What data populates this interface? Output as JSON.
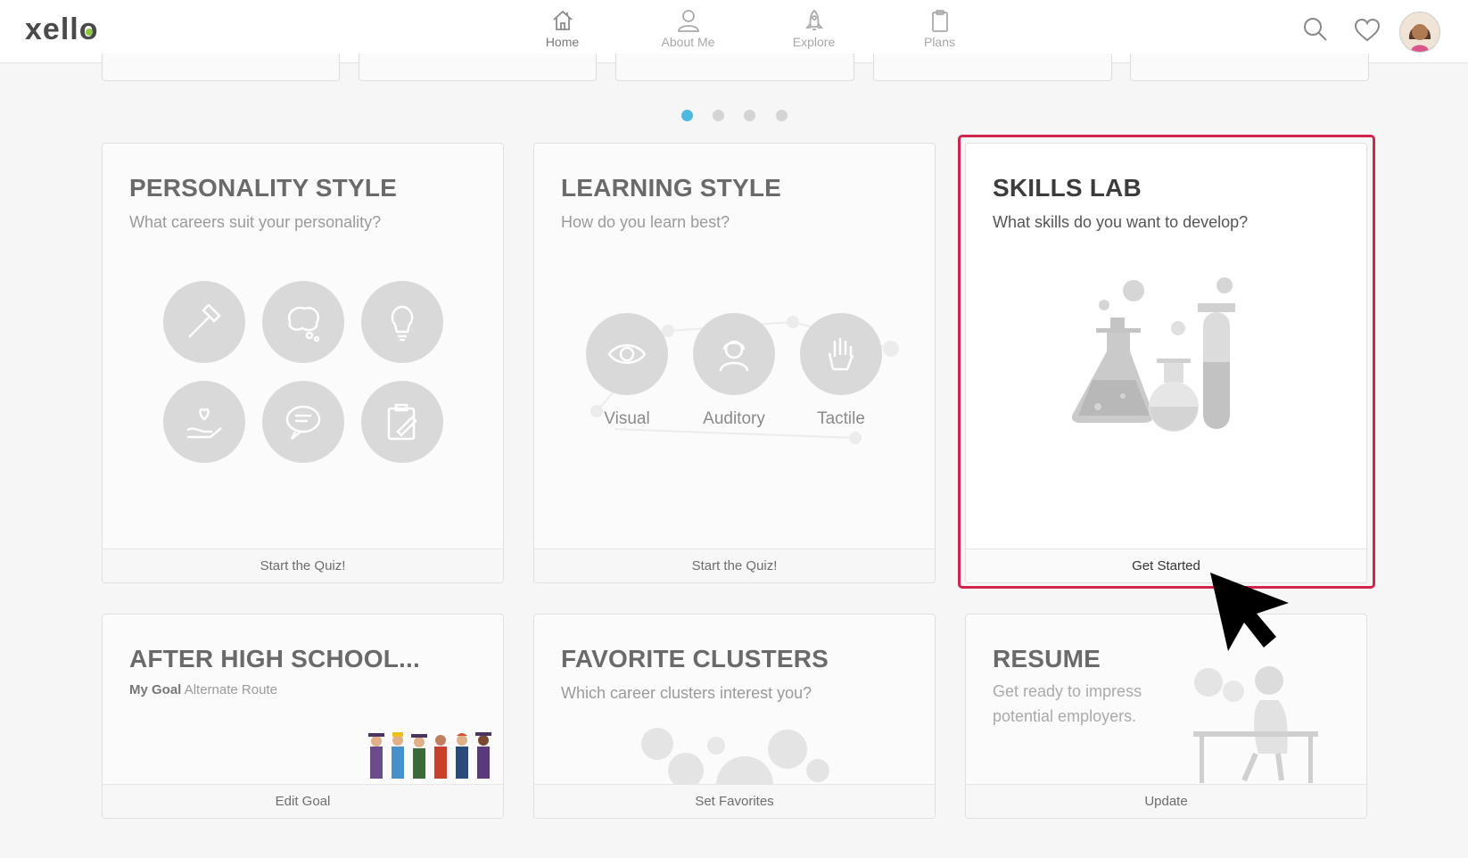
{
  "app": {
    "logo": "xello"
  },
  "nav": {
    "items": [
      {
        "label": "Home",
        "icon": "home-icon",
        "active": true
      },
      {
        "label": "About Me",
        "icon": "person-icon",
        "active": false
      },
      {
        "label": "Explore",
        "icon": "rocket-icon",
        "active": false
      },
      {
        "label": "Plans",
        "icon": "clipboard-icon",
        "active": false
      }
    ]
  },
  "header_actions": {
    "search_icon": "search-icon",
    "favorites_icon": "heart-icon",
    "avatar": "user-avatar"
  },
  "carousel": {
    "pages": 4,
    "active_page": 1
  },
  "cards": {
    "personality": {
      "title": "PERSONALITY STYLE",
      "subtitle": "What careers suit your personality?",
      "action": "Start the Quiz!"
    },
    "learning": {
      "title": "LEARNING STYLE",
      "subtitle": "How do you learn best?",
      "action": "Start the Quiz!",
      "styles": [
        "Visual",
        "Auditory",
        "Tactile"
      ]
    },
    "skills": {
      "title": "SKILLS LAB",
      "subtitle": "What skills do you want to develop?",
      "action": "Get Started"
    },
    "after_hs": {
      "title": "AFTER HIGH SCHOOL...",
      "goal_label": "My Goal",
      "goal_value": "Alternate Route",
      "action": "Edit Goal"
    },
    "clusters": {
      "title": "FAVORITE CLUSTERS",
      "subtitle": "Which career clusters interest you?",
      "action": "Set Favorites"
    },
    "resume": {
      "title": "RESUME",
      "subtitle": "Get ready to impress potential employers.",
      "action": "Update"
    }
  },
  "colors": {
    "accent_purple": "#b28fd1",
    "dot_active": "#4fb8e0",
    "highlight": "#d2254d",
    "logo_green": "#8cc63f"
  }
}
